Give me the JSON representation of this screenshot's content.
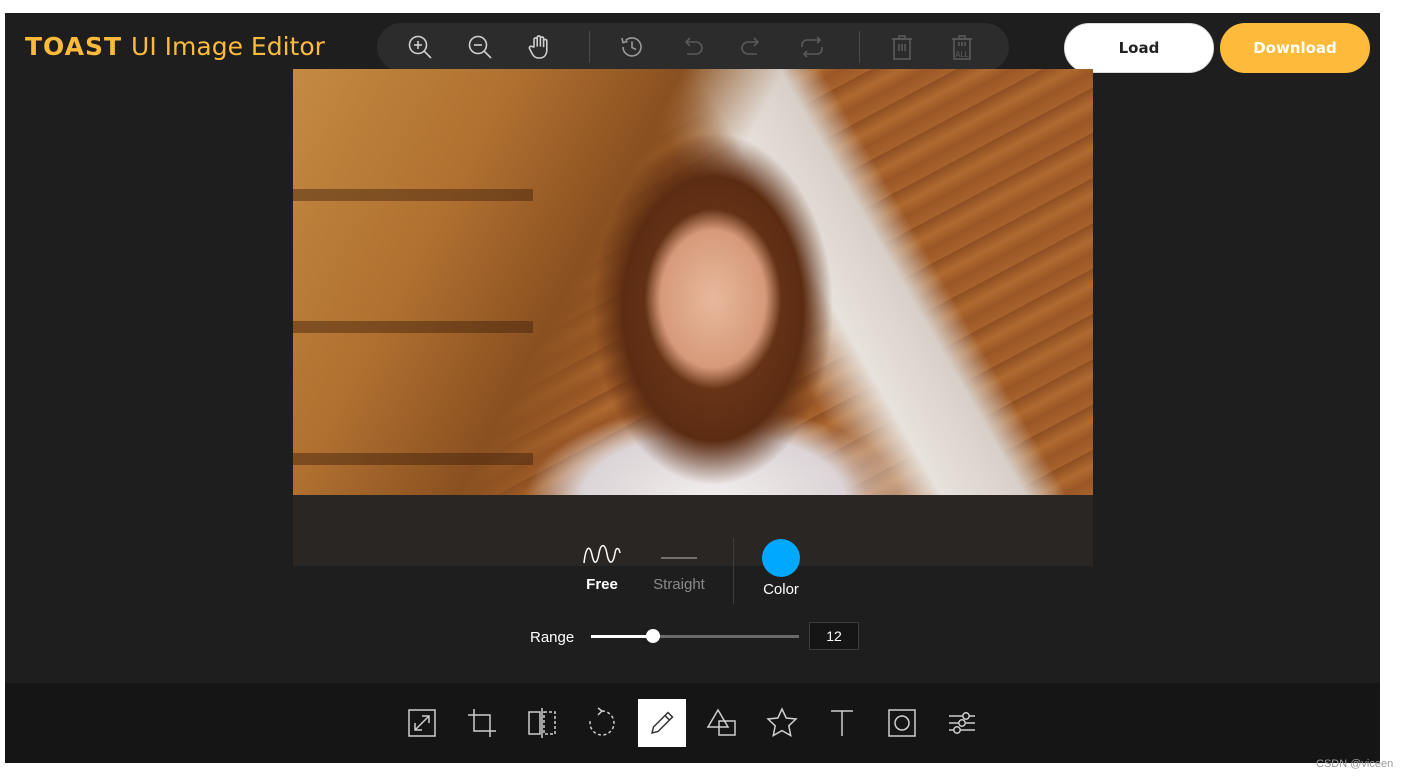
{
  "header": {
    "logo_brand": "TOAST",
    "logo_rest": "UI Image Editor",
    "load_label": "Load",
    "download_label": "Download",
    "accent_color": "#fdba3b"
  },
  "top_menu": {
    "items": [
      {
        "name": "zoom-in-icon"
      },
      {
        "name": "zoom-out-icon"
      },
      {
        "name": "hand-icon"
      },
      {
        "name": "history-icon"
      },
      {
        "name": "undo-icon"
      },
      {
        "name": "redo-icon"
      },
      {
        "name": "reset-icon"
      },
      {
        "name": "delete-icon"
      },
      {
        "name": "delete-all-icon"
      }
    ],
    "delete_all_label": "ALL"
  },
  "draw_submenu": {
    "free_label": "Free",
    "straight_label": "Straight",
    "color_label": "Color",
    "selected_color": "#00a9ff",
    "selected_mode": "Free",
    "range_label": "Range",
    "range_value": "12",
    "range_fraction": 0.3
  },
  "bottom_menu": {
    "items": [
      {
        "name": "resize-icon"
      },
      {
        "name": "crop-icon"
      },
      {
        "name": "flip-icon"
      },
      {
        "name": "rotate-icon"
      },
      {
        "name": "draw-icon",
        "active": true
      },
      {
        "name": "shape-icon"
      },
      {
        "name": "icon-icon"
      },
      {
        "name": "text-icon"
      },
      {
        "name": "mask-icon"
      },
      {
        "name": "filter-icon"
      }
    ]
  },
  "watermark": "CSDN @viceen"
}
